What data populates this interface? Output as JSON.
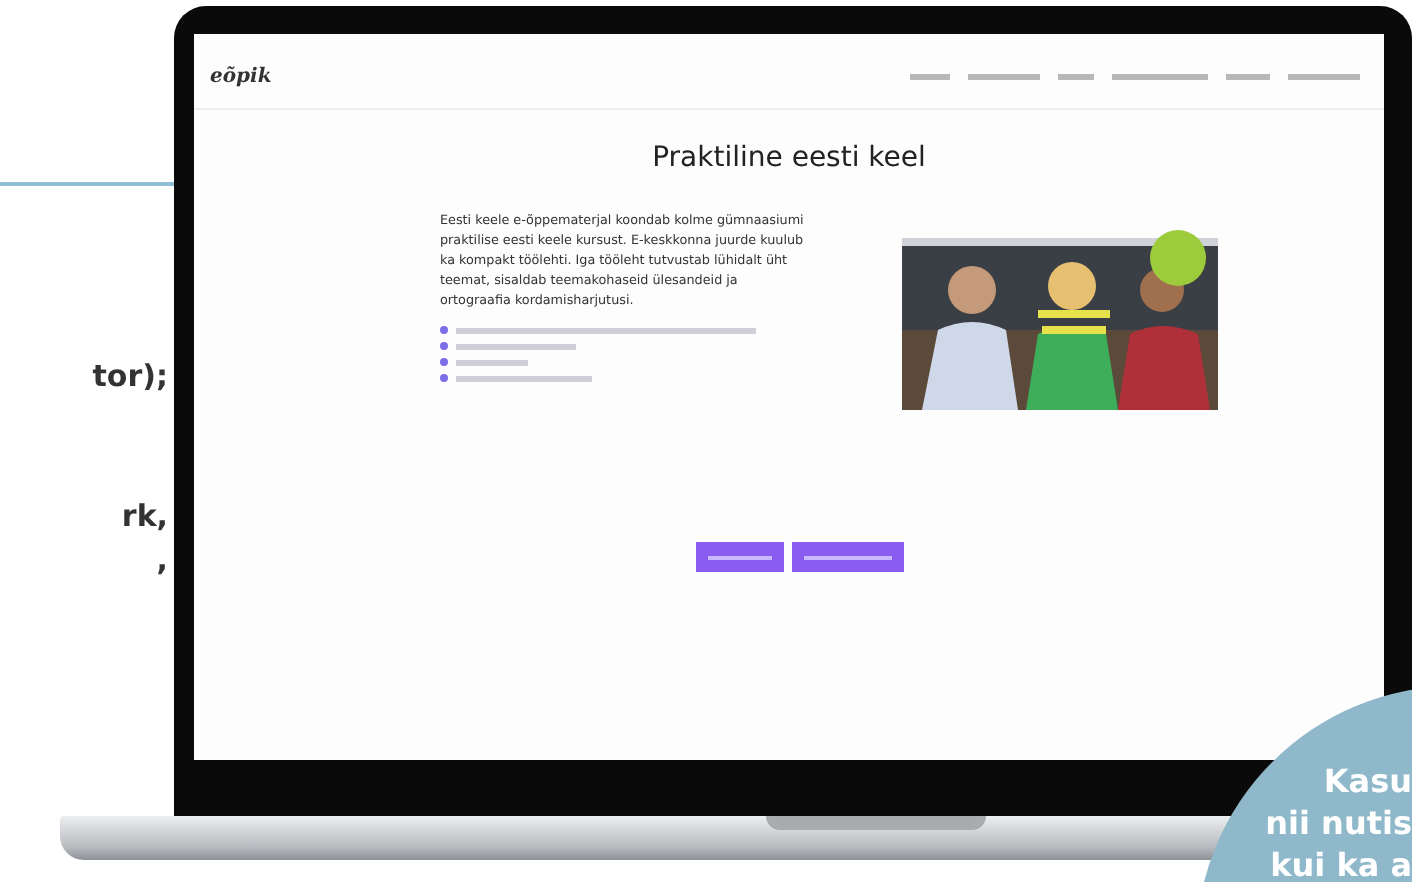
{
  "side_text": [
    "tor);",
    "rk,",
    ","
  ],
  "page": {
    "logo": "eõpik",
    "title": "Praktiline eesti keel",
    "intro": "Eesti keele e-õppematerjal koondab kolme gümnaasiumi praktilise eesti keele kursust. E-keskkonna juurde kuulub ka kompakt töölehti. Iga tööleht tutvustab lühidalt üht teemat, sisaldab teemakohaseid ülesandeid ja ortograafia kordamisharjutusi."
  },
  "circle_text": [
    "Kasu",
    "nii nutis",
    "kui ka a"
  ]
}
